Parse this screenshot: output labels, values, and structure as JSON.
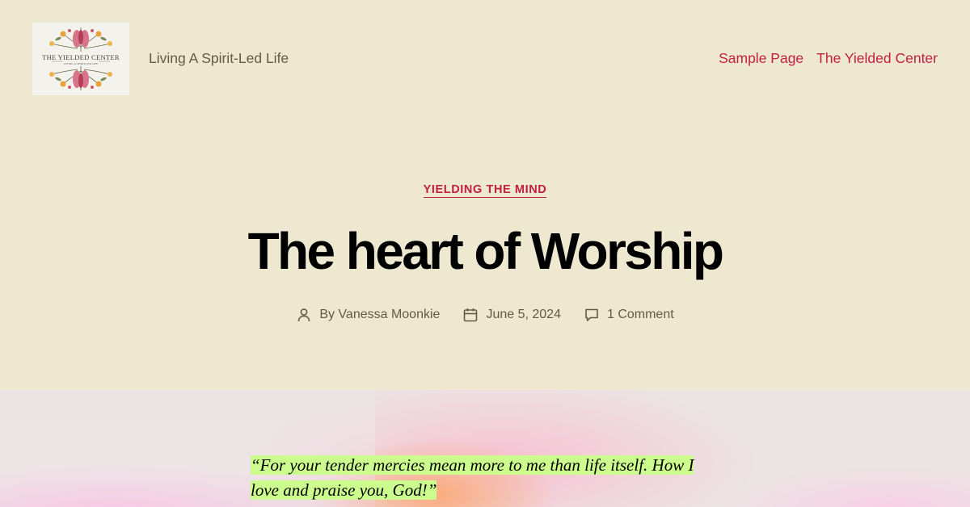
{
  "site": {
    "logo_text": "THE YIELDED CENTER",
    "logo_subtext": "LIVING A SPIRIT-LED LIFE",
    "tagline": "Living A Spirit-Led Life"
  },
  "nav": {
    "items": [
      {
        "label": "Sample Page"
      },
      {
        "label": "The Yielded Center"
      }
    ]
  },
  "post": {
    "category": "YIELDING THE MIND",
    "title": "The heart of Worship",
    "author": "By Vanessa Moonkie",
    "date": "June 5, 2024",
    "comments": "1 Comment",
    "quote": "“For your tender mercies mean more to me than life itself. How I love and praise you, God!”"
  },
  "colors": {
    "background": "#efe8d0",
    "accent": "#c1203f",
    "meta_text": "#625c45",
    "quote_highlight": "#ccfc8e"
  },
  "icons": {
    "author": "person-icon",
    "date": "calendar-icon",
    "comments": "comment-bubble-icon"
  }
}
